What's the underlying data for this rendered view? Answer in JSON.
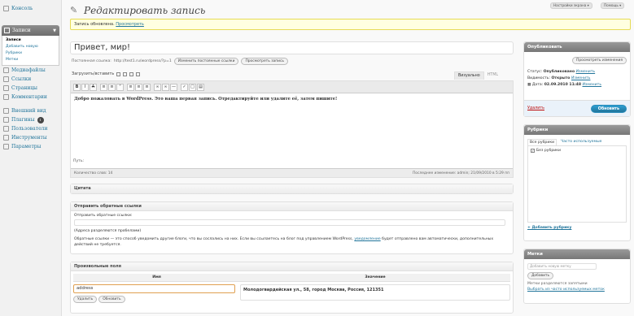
{
  "topbar": {
    "settings_label": "Настройки экрана ▾",
    "help_label": "Помощь ▾"
  },
  "sidebar": {
    "console": "Консоль",
    "posts": "Записи",
    "posts_sub": [
      "Записи",
      "Добавить новую",
      "Рубрики",
      "Метки"
    ],
    "items_a": [
      "Медиафайлы",
      "Ссылки",
      "Страницы",
      "Комментарии"
    ],
    "items_b": [
      "Внешний вид",
      "Плагины",
      "Пользователи",
      "Инструменты",
      "Параметры"
    ],
    "plugins_badge": "1"
  },
  "page": {
    "title": "Редактировать запись"
  },
  "notice": {
    "text": "Запись обновлена.",
    "link": "Просмотреть"
  },
  "post": {
    "title": "Привет, мир!",
    "permalink_label": "Постоянная ссылка:",
    "permalink_url": "http://test1.ru/wordpress/?p=1",
    "change_permalink_btn": "Изменить постоянные ссылки",
    "view_post_btn": "Просмотреть запись",
    "upload_label": "Загрузить/вставить",
    "tab_visual": "Визуально",
    "tab_html": "HTML",
    "content": "Добро пожаловать в WordPress. Это ваша первая запись. Отредактируйте или удалите её, затем пишите!",
    "path_label": "Путь:",
    "word_count": "Количество слов: 14",
    "last_edited": "Последнее изменение: admin; 21/09/2010 в 5:29 пп"
  },
  "excerpt": {
    "title": "Цитата"
  },
  "trackbacks": {
    "title": "Отправить обратные ссылки",
    "send_label": "Отправить обратные ссылки:",
    "hint": "(Адреса разделяются пробелами)",
    "description": "Обратные ссылки — это способ уведомить другие блоги, что вы сослались на них. Если вы ссылаетесь на блог под управлением WordPress,",
    "description_link": "уведомление",
    "description_tail": "будет отправлено вам автоматически, дополнительных действий не требуется."
  },
  "custom_fields": {
    "title": "Произвольные поля",
    "col_name": "Имя",
    "col_value": "Значение",
    "name_value": "address",
    "value_text": "Молодогвардейская ул., 58, город Москва, Россия, 121351",
    "delete_btn": "Удалить",
    "update_btn": "Обновить"
  },
  "publish": {
    "title": "Опубликовать",
    "preview_btn": "Просмотреть изменения",
    "status_label": "Статус:",
    "status_value": "Опубликовано",
    "status_edit": "Изменить",
    "visibility_label": "Видимость:",
    "visibility_value": "Открыто",
    "visibility_edit": "Изменить",
    "date_label": "Дата:",
    "date_value": "02.09.2010 11:48",
    "date_edit": "Изменить",
    "delete_link": "Удалить",
    "update_btn": "Обновить"
  },
  "categories": {
    "title": "Рубрики",
    "tab_all": "Все рубрики",
    "tab_popular": "Часто используемые",
    "item": "Без рубрики",
    "add_link": "+ Добавить рубрику"
  },
  "tags": {
    "title": "Метки",
    "input_placeholder": "Добавить новую метку",
    "add_btn": "Добавить",
    "hint": "Метки разделяются запятыми",
    "choose_link": "Выбрать из часто используемых меток"
  }
}
